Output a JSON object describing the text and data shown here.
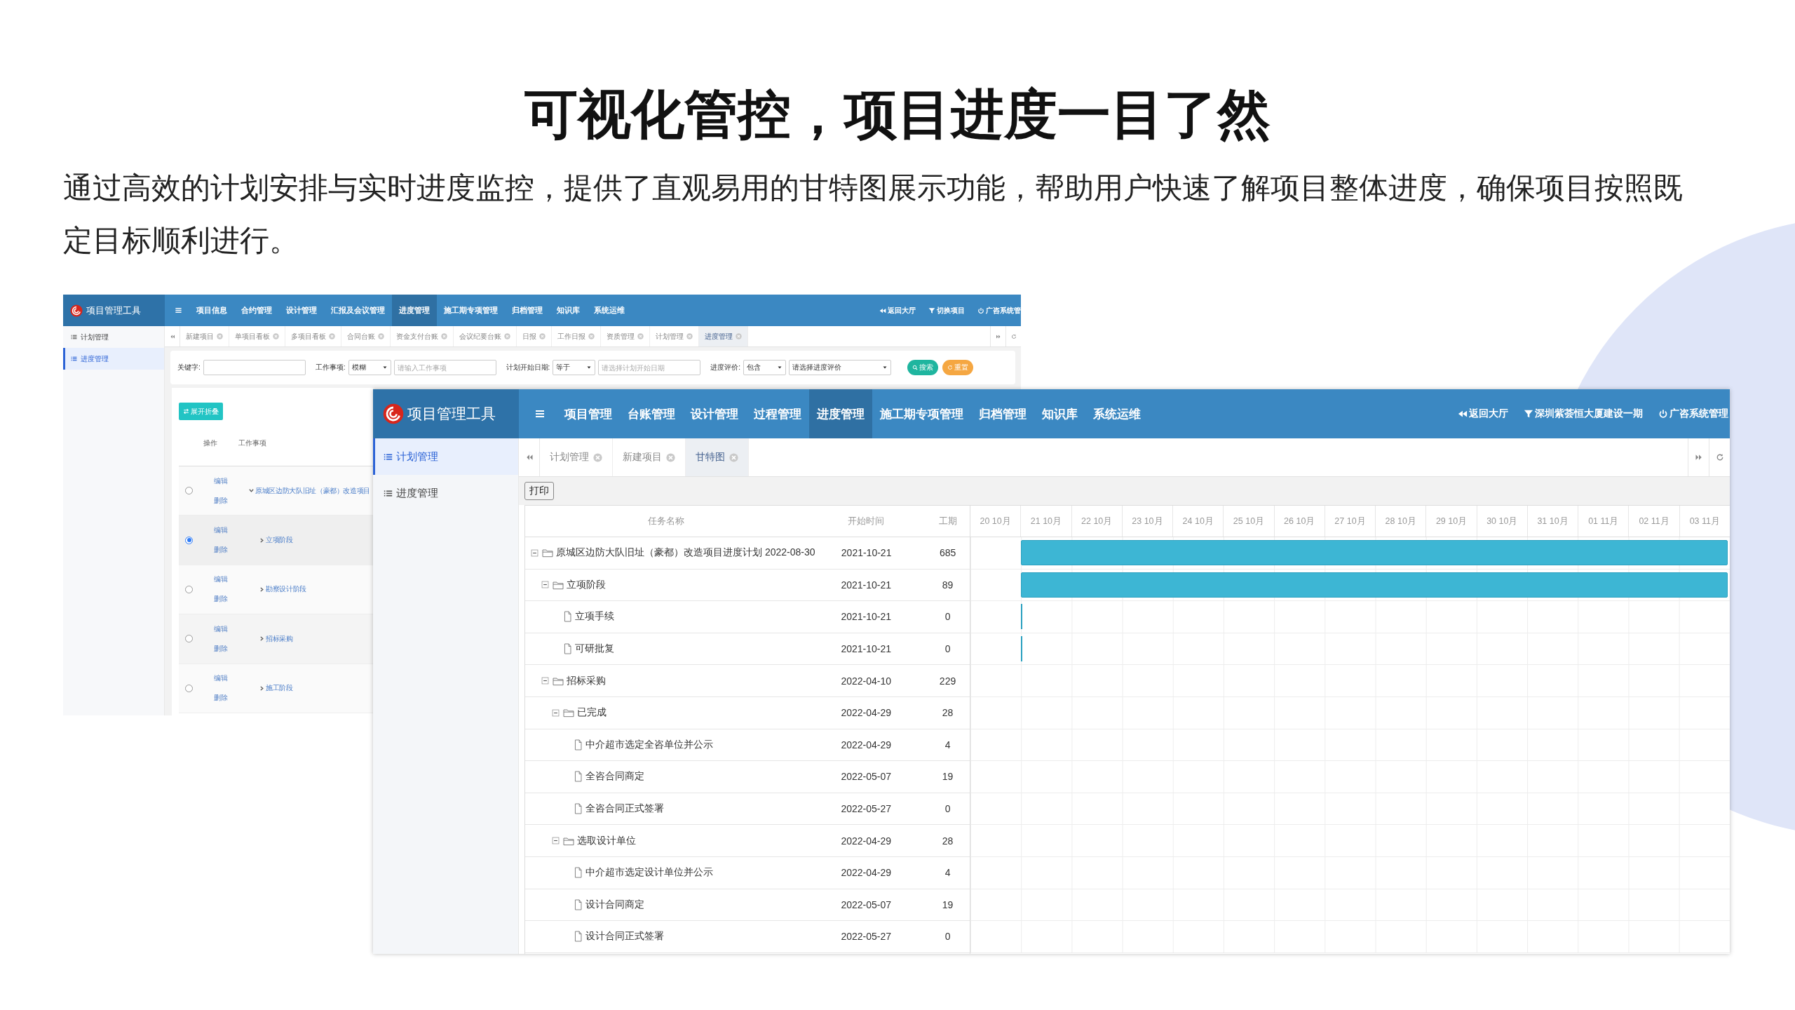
{
  "slide": {
    "title": "可视化管控，项目进度一目了然",
    "description": "通过高效的计划安排与实时进度监控，提供了直观易用的甘特图展示功能，帮助用户快速了解项目整体进度，确保项目按照既定目标顺利进行。"
  },
  "back_window": {
    "app_title": "项目管理工具",
    "nav": [
      {
        "label": "项目信息",
        "selected": false
      },
      {
        "label": "合约管理",
        "selected": false
      },
      {
        "label": "设计管理",
        "selected": false
      },
      {
        "label": "汇报及会议管理",
        "selected": false
      },
      {
        "label": "进度管理",
        "selected": true
      },
      {
        "label": "施工期专项管理",
        "selected": false
      },
      {
        "label": "归档管理",
        "selected": false
      },
      {
        "label": "知识库",
        "selected": false
      },
      {
        "label": "系统运维",
        "selected": false
      }
    ],
    "header_links": [
      {
        "kind": "back",
        "label": "返回大厅"
      },
      {
        "kind": "switch",
        "label": "切换项目"
      },
      {
        "kind": "power",
        "label": "广咨系统管"
      }
    ],
    "sidebar": [
      {
        "label": "计划管理",
        "selected": false
      },
      {
        "label": "进度管理",
        "selected": true
      }
    ],
    "tabs": [
      {
        "label": "新建项目",
        "selected": false
      },
      {
        "label": "单项目看板",
        "selected": false
      },
      {
        "label": "多项目看板",
        "selected": false
      },
      {
        "label": "合同台账",
        "selected": false
      },
      {
        "label": "资金支付台账",
        "selected": false
      },
      {
        "label": "会议纪要台账",
        "selected": false
      },
      {
        "label": "日报",
        "selected": false
      },
      {
        "label": "工作日报",
        "selected": false
      },
      {
        "label": "资质管理",
        "selected": false
      },
      {
        "label": "计划管理",
        "selected": false
      },
      {
        "label": "进度管理",
        "selected": true
      }
    ],
    "filters": [
      {
        "label": "关键字:",
        "controls": [
          {
            "kind": "input"
          }
        ]
      },
      {
        "label": "工作事项:",
        "controls": [
          {
            "kind": "select",
            "value": "模糊"
          },
          {
            "kind": "input",
            "placeholder": "请输入工作事项"
          }
        ]
      },
      {
        "label": "计划开始日期:",
        "controls": [
          {
            "kind": "select",
            "value": "等于"
          },
          {
            "kind": "input",
            "placeholder": "请选择计划开始日期"
          }
        ]
      },
      {
        "label": "进度评价:",
        "controls": [
          {
            "kind": "select",
            "value": "包含"
          },
          {
            "kind": "select",
            "value": "请选择进度评价"
          }
        ]
      }
    ],
    "actions": [
      {
        "kind": "search",
        "label": "搜索"
      },
      {
        "kind": "reset",
        "label": "重置"
      }
    ],
    "expand_button": "展开折叠",
    "columns": [
      "操作",
      "工作事项"
    ],
    "rows": [
      {
        "selected": false,
        "actions": [
          "编辑",
          "删除"
        ],
        "expanded": true,
        "task": "原城区边防大队旧址（豪都）改造项目",
        "children": [
          {
            "selected": true,
            "actions": [
              "编辑",
              "删除"
            ],
            "expanded": false,
            "task": "立项阶段"
          },
          {
            "selected": false,
            "actions": [
              "编辑",
              "删除"
            ],
            "expanded": false,
            "task": "勘察设计阶段"
          },
          {
            "selected": false,
            "actions": [
              "编辑",
              "删除"
            ],
            "expanded": false,
            "task": "招标采购"
          },
          {
            "selected": false,
            "actions": [
              "编辑",
              "删除"
            ],
            "expanded": false,
            "task": "施工阶段"
          }
        ]
      }
    ]
  },
  "front_window": {
    "app_title": "项目管理工具",
    "nav": [
      {
        "label": "项目管理",
        "selected": false
      },
      {
        "label": "台账管理",
        "selected": false
      },
      {
        "label": "设计管理",
        "selected": false
      },
      {
        "label": "过程管理",
        "selected": false
      },
      {
        "label": "进度管理",
        "selected": true
      },
      {
        "label": "施工期专项管理",
        "selected": false
      },
      {
        "label": "归档管理",
        "selected": false
      },
      {
        "label": "知识库",
        "selected": false
      },
      {
        "label": "系统运维",
        "selected": false
      }
    ],
    "header_links": [
      {
        "kind": "back",
        "label": "返回大厅"
      },
      {
        "kind": "switch",
        "label": "深圳紫荟恒大厦建设一期"
      },
      {
        "kind": "power",
        "label": "广咨系统管理"
      }
    ],
    "sidebar": [
      {
        "label": "计划管理",
        "selected": true
      },
      {
        "label": "进度管理",
        "selected": false
      }
    ],
    "tabs": [
      {
        "label": "计划管理",
        "selected": false
      },
      {
        "label": "新建项目",
        "selected": false
      },
      {
        "label": "甘特图",
        "selected": true
      }
    ],
    "print_button": "打印",
    "columns": [
      "任务名称",
      "开始时间",
      "工期"
    ],
    "timeline": [
      "20 10月",
      "21 10月",
      "22 10月",
      "23 10月",
      "24 10月",
      "25 10月",
      "26 10月",
      "27 10月",
      "28 10月",
      "29 10月",
      "30 10月",
      "31 10月",
      "01 11月",
      "02 11月",
      "03 11月"
    ],
    "tasks": [
      {
        "name": "原城区边防大队旧址（豪都）改造项目进度计划 2022-08-30",
        "start": "2021-10-21",
        "duration": "685",
        "expanded": true,
        "children": [
          {
            "name": "立项阶段",
            "start": "2021-10-21",
            "duration": "89",
            "expanded": true,
            "children": [
              {
                "name": "立项手续",
                "start": "2021-10-21",
                "duration": "0"
              },
              {
                "name": "可研批复",
                "start": "2021-10-21",
                "duration": "0"
              }
            ]
          },
          {
            "name": "招标采购",
            "start": "2022-04-10",
            "duration": "229",
            "expanded": true,
            "children": [
              {
                "name": "已完成",
                "start": "2022-04-29",
                "duration": "28",
                "expanded": true,
                "children": [
                  {
                    "name": "中介超市选定全咨单位并公示",
                    "start": "2022-04-29",
                    "duration": "4"
                  },
                  {
                    "name": "全咨合同商定",
                    "start": "2022-05-07",
                    "duration": "19"
                  },
                  {
                    "name": "全咨合同正式签署",
                    "start": "2022-05-27",
                    "duration": "0"
                  }
                ]
              },
              {
                "name": "选取设计单位",
                "start": "2022-04-29",
                "duration": "28",
                "expanded": true,
                "children": [
                  {
                    "name": "中介超市选定设计单位并公示",
                    "start": "2022-04-29",
                    "duration": "4"
                  },
                  {
                    "name": "设计合同商定",
                    "start": "2022-05-07",
                    "duration": "19"
                  },
                  {
                    "name": "设计合同正式签署",
                    "start": "2022-05-27",
                    "duration": "0"
                  }
                ]
              }
            ]
          }
        ]
      }
    ]
  }
}
